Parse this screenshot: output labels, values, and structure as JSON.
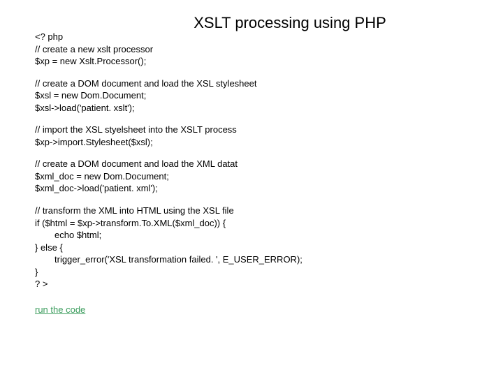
{
  "title": "XSLT processing using PHP",
  "code": {
    "p1": {
      "l1": "<? php",
      "l2": "// create a new xslt processor",
      "l3": "$xp = new Xslt.Processor();"
    },
    "p2": {
      "l1": "// create a DOM document and load the XSL stylesheet",
      "l2": "$xsl = new Dom.Document;",
      "l3": "$xsl->load('patient. xslt');"
    },
    "p3": {
      "l1": "// import the XSL styelsheet into the XSLT process",
      "l2": "$xp->import.Stylesheet($xsl);"
    },
    "p4": {
      "l1": "// create a DOM document and load the XML datat",
      "l2": "$xml_doc = new Dom.Document;",
      "l3": "$xml_doc->load('patient. xml');"
    },
    "p5": {
      "l1": "// transform the XML into HTML using the XSL file",
      "l2": "if ($html = $xp->transform.To.XML($xml_doc)) {",
      "l3": "echo $html;",
      "l4": "} else {",
      "l5": "trigger_error('XSL transformation failed. ', E_USER_ERROR);",
      "l6": "}",
      "l7": "? >"
    }
  },
  "link_text": "run the code"
}
